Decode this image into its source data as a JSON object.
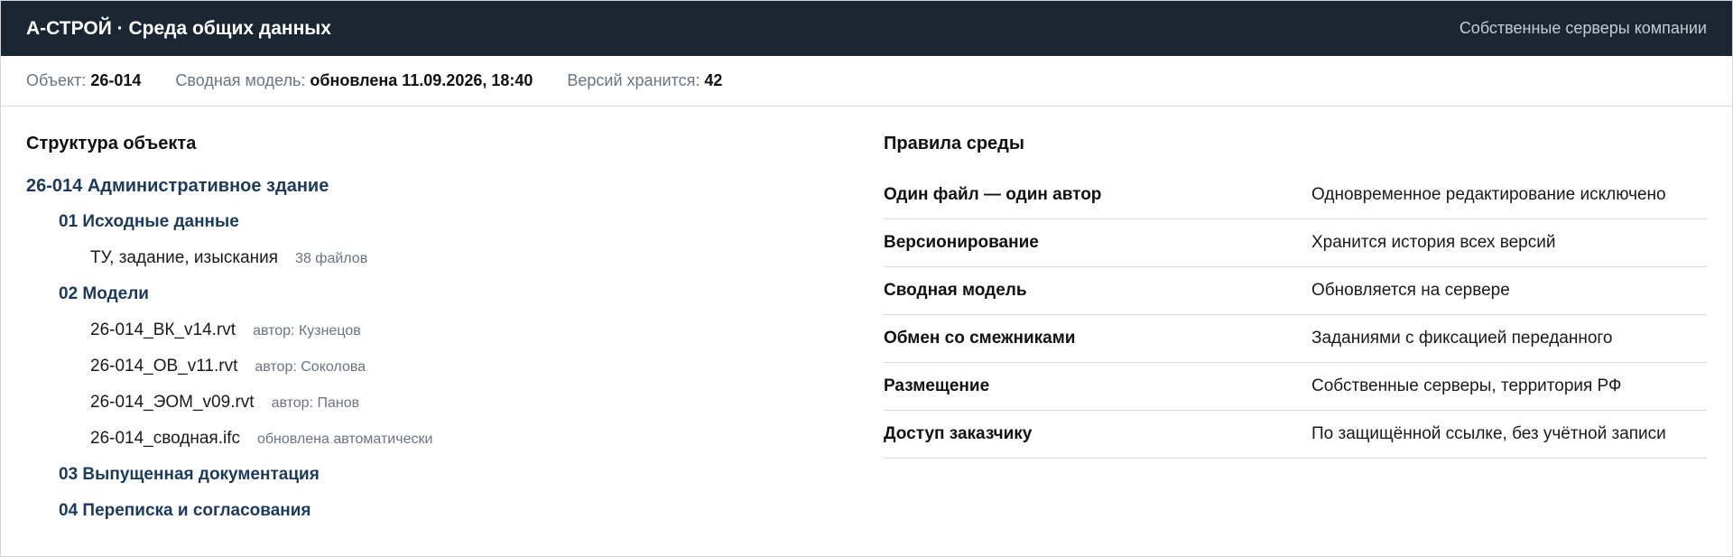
{
  "header": {
    "title": "А-СТРОЙ · Среда общих данных",
    "servers_note": "Собственные серверы компании"
  },
  "meta": {
    "object_label": "Объект:",
    "object_value": "26-014",
    "model_label": "Сводная модель:",
    "model_value": "обновлена 11.09.2026, 18:40",
    "versions_label": "Версий хранится:",
    "versions_value": "42"
  },
  "structure": {
    "title": "Структура объекта",
    "root": "26-014 Административное здание",
    "folder1": "01 Исходные данные",
    "folder1_files": [
      {
        "name": "ТУ, задание, изыскания",
        "note": "38 файлов"
      }
    ],
    "folder2": "02 Модели",
    "folder2_files": [
      {
        "name": "26-014_ВК_v14.rvt",
        "note": "автор: Кузнецов"
      },
      {
        "name": "26-014_ОВ_v11.rvt",
        "note": "автор: Соколова"
      },
      {
        "name": "26-014_ЭОМ_v09.rvt",
        "note": "автор: Панов"
      },
      {
        "name": "26-014_сводная.ifc",
        "note": "обновлена автоматически"
      }
    ],
    "folder3": "03 Выпущенная документация",
    "folder4": "04 Переписка и согласования"
  },
  "rules": {
    "title": "Правила среды",
    "items": [
      {
        "name": "Один файл — один автор",
        "value": "Одновременное редактирование исключено"
      },
      {
        "name": "Версионирование",
        "value": "Хранится история всех версий"
      },
      {
        "name": "Сводная модель",
        "value": "Обновляется на сервере"
      },
      {
        "name": "Обмен со смежниками",
        "value": "Заданиями с фиксацией переданного"
      },
      {
        "name": "Размещение",
        "value": "Собственные серверы, территория РФ"
      },
      {
        "name": "Доступ заказчику",
        "value": "По защищённой ссылке, без учётной записи"
      }
    ]
  }
}
